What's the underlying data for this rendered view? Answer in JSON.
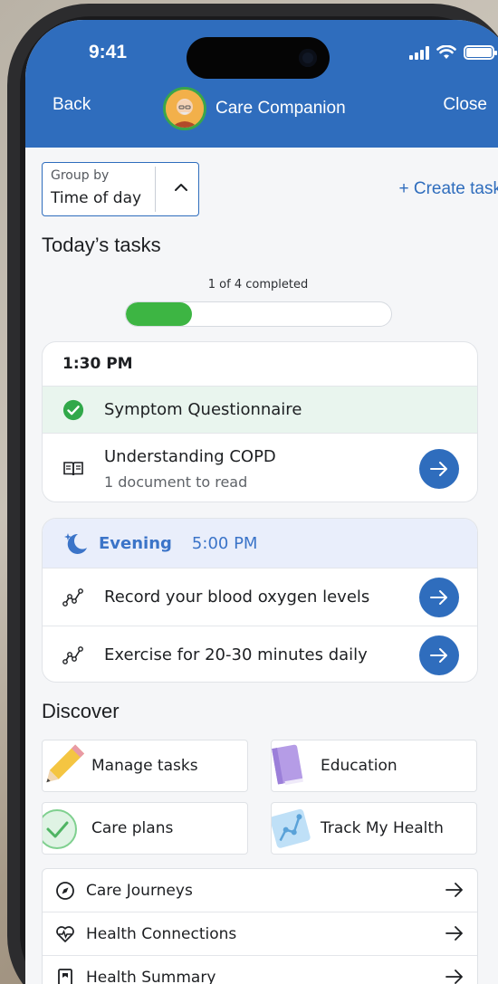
{
  "status": {
    "time": "9:41"
  },
  "header": {
    "back_label": "Back",
    "title": "Care Companion",
    "close_label": "Close"
  },
  "group_by": {
    "label": "Group by",
    "value": "Time of day"
  },
  "create_task_label": "+ Create task",
  "todays_tasks": {
    "title": "Today’s tasks",
    "progress_text": "1 of 4 completed",
    "progress_fraction": 0.25
  },
  "afternoon": {
    "time_label": "1:30 PM",
    "items": [
      {
        "label": "Symptom Questionnaire",
        "completed": true
      },
      {
        "label": "Understanding COPD",
        "sub": "1 document to read"
      }
    ]
  },
  "evening": {
    "label": "Evening",
    "time": "5:00 PM",
    "items": [
      {
        "label": "Record your blood oxygen levels"
      },
      {
        "label": "Exercise for 20-30 minutes daily"
      }
    ]
  },
  "discover": {
    "title": "Discover",
    "tiles": [
      {
        "label": "Manage tasks",
        "icon": "pencil-icon"
      },
      {
        "label": "Education",
        "icon": "book-icon"
      },
      {
        "label": "Care plans",
        "icon": "check-circle-icon"
      },
      {
        "label": "Track My Health",
        "icon": "chart-icon"
      }
    ],
    "links": [
      {
        "label": "Care Journeys",
        "icon": "compass-icon"
      },
      {
        "label": "Health Connections",
        "icon": "heart-pulse-icon"
      },
      {
        "label": "Health Summary",
        "icon": "document-icon"
      }
    ]
  },
  "colors": {
    "primary": "#2f6dbd",
    "success": "#3db543",
    "evening_bg": "#e9eefb"
  }
}
